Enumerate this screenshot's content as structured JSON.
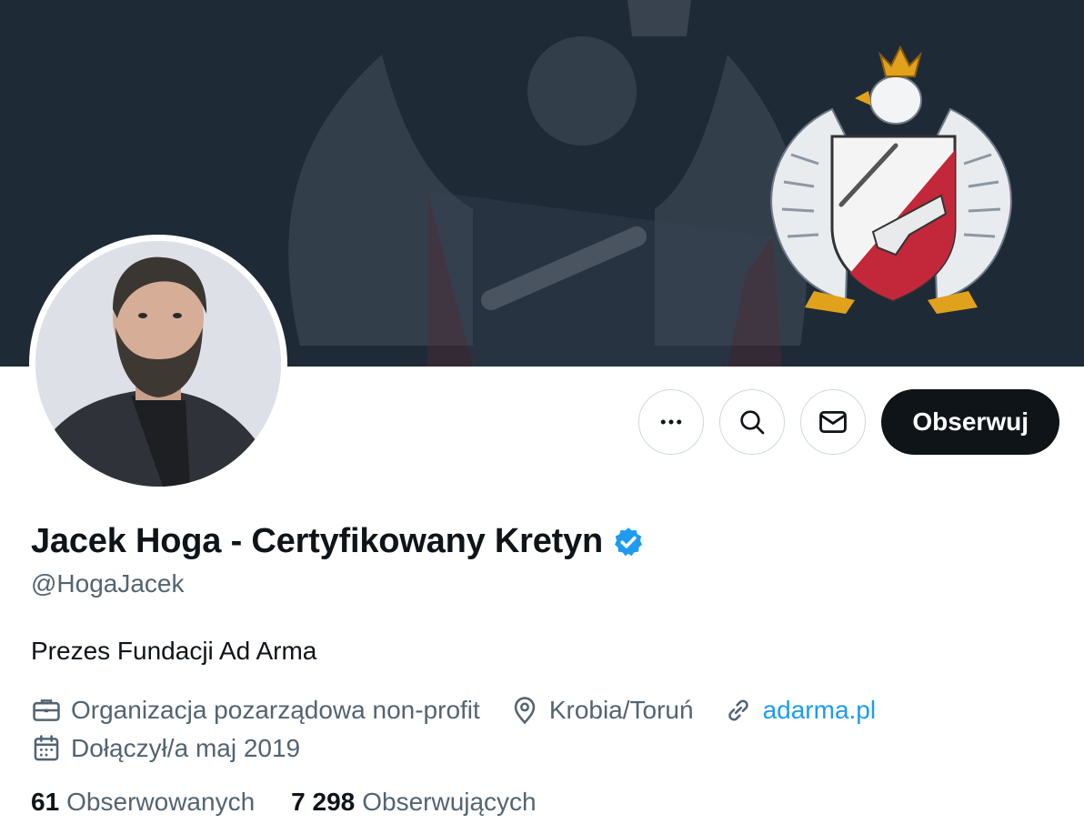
{
  "profile": {
    "name": "Jacek Hoga - Certyfikowany Kretyn",
    "handle": "@HogaJacek",
    "bio": "Prezes Fundacji Ad Arma",
    "verified": true,
    "verified_icon": "verified-badge-icon"
  },
  "actions": {
    "more_icon": "more-icon",
    "search_icon": "search-icon",
    "message_icon": "mail-icon",
    "follow_label": "Obserwuj"
  },
  "meta": {
    "category": "Organizacja pozarządowa non-profit",
    "category_icon": "briefcase-icon",
    "location": "Krobia/Toruń",
    "location_icon": "location-pin-icon",
    "website": "adarma.pl",
    "website_icon": "link-icon",
    "joined": "Dołączył/a maj 2019",
    "joined_icon": "calendar-icon"
  },
  "stats": {
    "following_count": "61",
    "following_label": "Obserwowanych",
    "followers_count": "7 298",
    "followers_label": "Obserwujących"
  },
  "colors": {
    "banner_bg": "#1f2a37",
    "accent": "#1d9bf0",
    "text_primary": "#0f1419",
    "text_secondary": "#536471",
    "follow_button": "#0f1419"
  }
}
